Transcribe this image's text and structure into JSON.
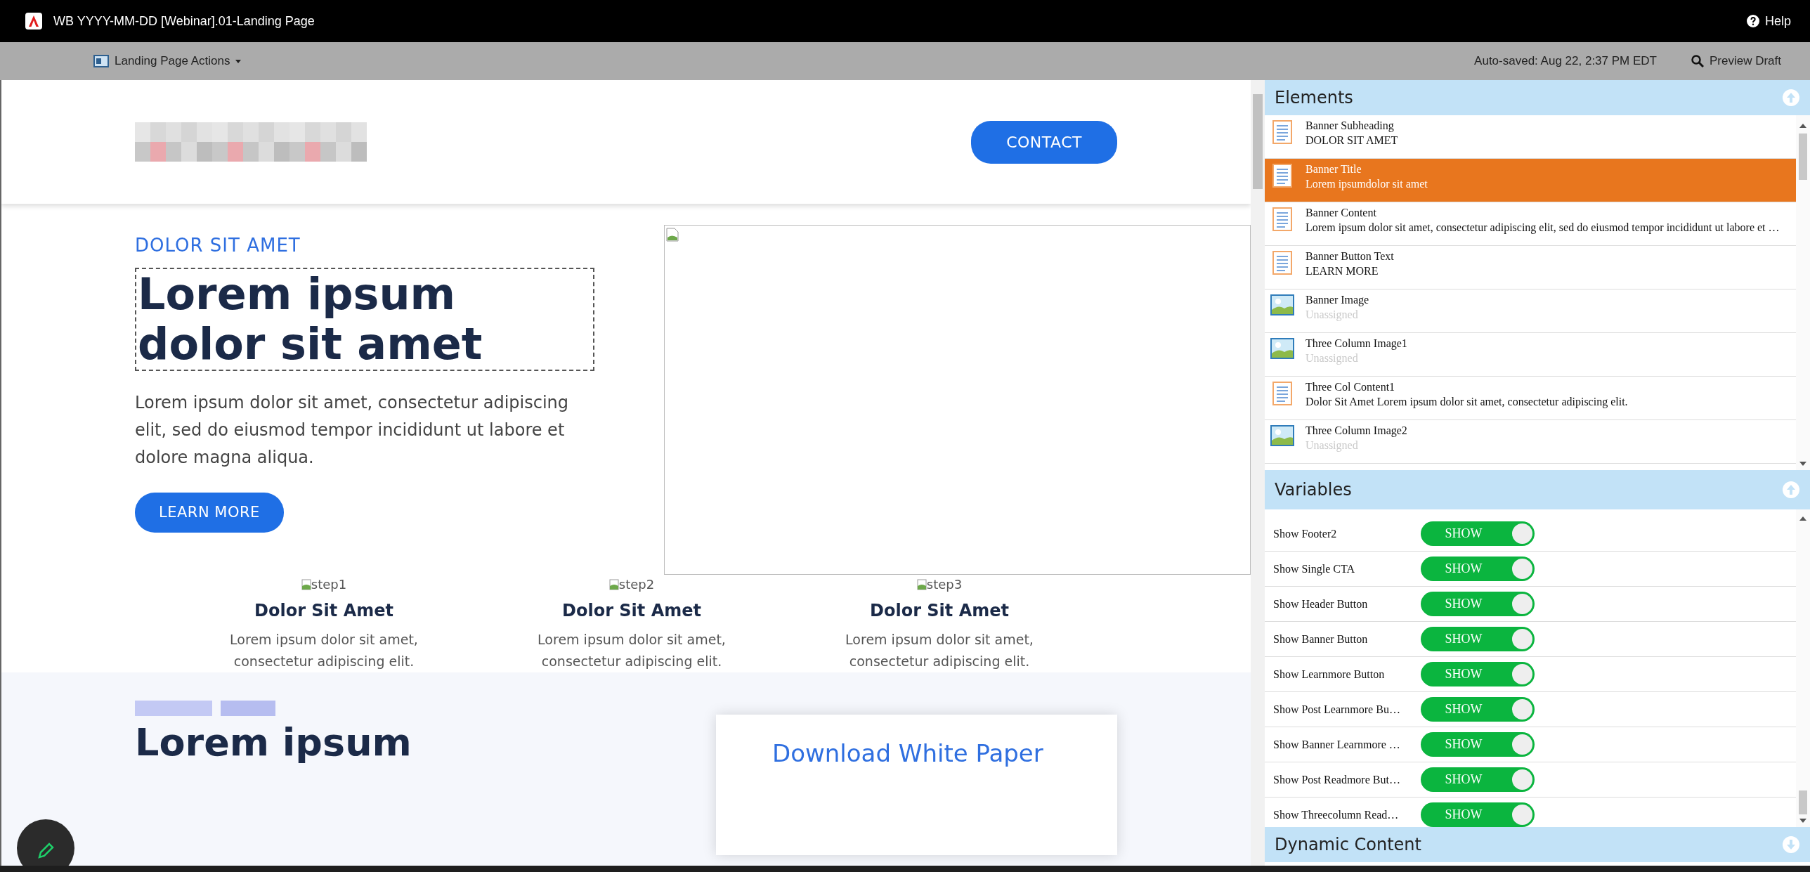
{
  "app_bar": {
    "title": "WB YYYY-MM-DD [Webinar].01-Landing Page",
    "help": "Help"
  },
  "toolbar": {
    "actions_menu": "Landing Page Actions",
    "autosave": "Auto-saved: Aug 22, 2:37 PM EDT",
    "preview": "Preview Draft"
  },
  "canvas": {
    "header": {
      "contact_button": "CONTACT"
    },
    "banner": {
      "subheading": "DOLOR SIT AMET",
      "title": "Lorem ipsum dolor sit amet",
      "content": "Lorem ipsum dolor sit amet, consectetur adipiscing elit, sed do eiusmod tempor incididunt ut labore et dolore magna aliqua.",
      "button": "LEARN MORE"
    },
    "columns": [
      {
        "image_alt": "step1",
        "heading": "Dolor Sit Amet",
        "text": "Lorem ipsum dolor sit amet, consectetur adipiscing elit."
      },
      {
        "image_alt": "step2",
        "heading": "Dolor Sit Amet",
        "text": "Lorem ipsum dolor sit amet, consectetur adipiscing elit."
      },
      {
        "image_alt": "step3",
        "heading": "Dolor Sit Amet",
        "text": "Lorem ipsum dolor sit amet, consectetur adipiscing elit."
      }
    ],
    "section2": {
      "heading": "Lorem ipsum",
      "card_link": "Download White Paper"
    }
  },
  "elements": {
    "title": "Elements",
    "items": [
      {
        "kind": "text",
        "name": "Banner Subheading",
        "value": "DOLOR SIT AMET",
        "assigned": true,
        "selected": false
      },
      {
        "kind": "text",
        "name": "Banner Title",
        "value": "Lorem ipsumdolor sit amet",
        "assigned": true,
        "selected": true
      },
      {
        "kind": "text",
        "name": "Banner Content",
        "value": "Lorem ipsum dolor sit amet, consectetur adipiscing elit, sed do eiusmod tempor incididunt ut labore et …",
        "assigned": true,
        "selected": false
      },
      {
        "kind": "text",
        "name": "Banner Button Text",
        "value": "LEARN MORE",
        "assigned": true,
        "selected": false
      },
      {
        "kind": "image",
        "name": "Banner Image",
        "value": "Unassigned",
        "assigned": false,
        "selected": false
      },
      {
        "kind": "image",
        "name": "Three Column Image1",
        "value": "Unassigned",
        "assigned": false,
        "selected": false
      },
      {
        "kind": "text",
        "name": "Three Col Content1",
        "value": "Dolor Sit Amet Lorem ipsum dolor sit amet, consectetur adipiscing elit.",
        "assigned": true,
        "selected": false
      },
      {
        "kind": "image",
        "name": "Three Column Image2",
        "value": "Unassigned",
        "assigned": false,
        "selected": false
      }
    ]
  },
  "variables": {
    "title": "Variables",
    "items": [
      {
        "label": "Show Footer2",
        "on": true,
        "state_label": "SHOW"
      },
      {
        "label": "Show Single CTA",
        "on": true,
        "state_label": "SHOW"
      },
      {
        "label": "Show Header Button",
        "on": true,
        "state_label": "SHOW"
      },
      {
        "label": "Show Banner Button",
        "on": true,
        "state_label": "SHOW"
      },
      {
        "label": "Show Learnmore Button",
        "on": true,
        "state_label": "SHOW"
      },
      {
        "label": "Show Post Learnmore Bu…",
        "on": true,
        "state_label": "SHOW"
      },
      {
        "label": "Show Banner Learnmore …",
        "on": true,
        "state_label": "SHOW"
      },
      {
        "label": "Show Post Readmore But…",
        "on": true,
        "state_label": "SHOW"
      },
      {
        "label": "Show Threecolumn Read…",
        "on": true,
        "state_label": "SHOW"
      }
    ]
  },
  "dynamic_content": {
    "title": "Dynamic Content",
    "expanded": false
  }
}
